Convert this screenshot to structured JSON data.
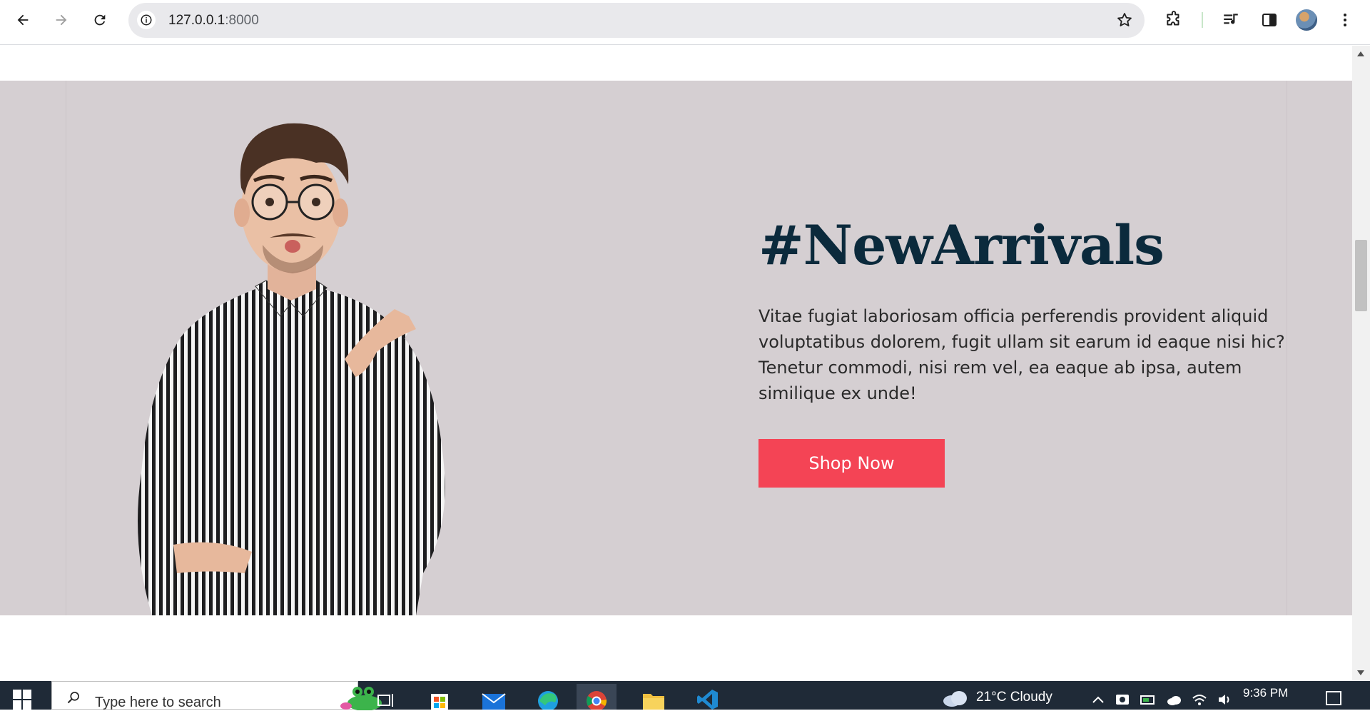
{
  "browser": {
    "url_host": "127.0.0.1",
    "url_port": ":8000"
  },
  "hero": {
    "title": "#NewArrivals",
    "description": "Vitae fugiat laboriosam officia perferendis provident aliquid voluptatibus dolorem, fugit ullam sit earum id eaque nisi hic? Tenetur commodi, nisi rem vel, ea eaque ab ipsa, autem similique ex unde!",
    "cta_label": "Shop Now",
    "background_color": "#d5cfd2",
    "title_color": "#0b2a3c",
    "cta_color": "#f44455"
  },
  "taskbar": {
    "search_placeholder": "Type here to search",
    "weather": "21°C  Cloudy",
    "time": "9:36 PM",
    "apps": [
      "task-view-icon",
      "microsoft-store-icon",
      "mail-icon",
      "edge-icon",
      "chrome-icon",
      "file-explorer-icon",
      "vscode-icon"
    ]
  }
}
